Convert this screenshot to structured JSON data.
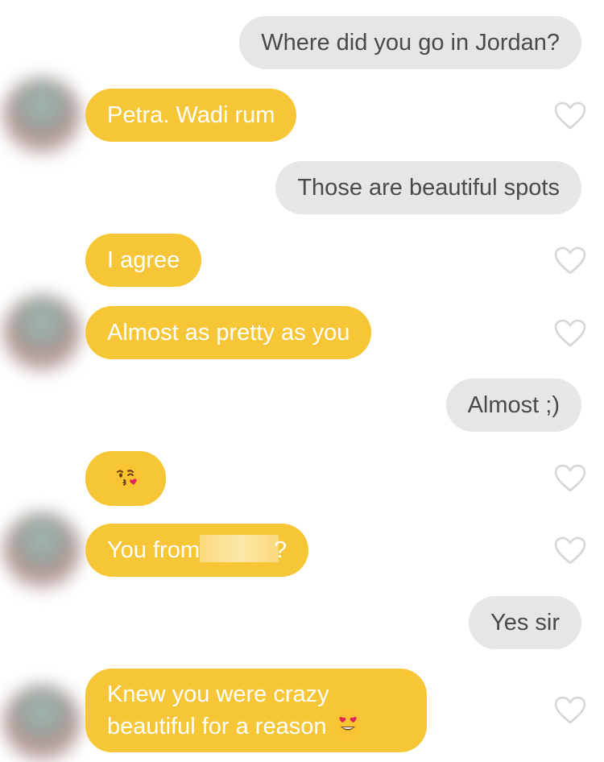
{
  "conversation": {
    "messages": [
      {
        "side": "out",
        "text": "Where did you go in Jordan?"
      },
      {
        "side": "in",
        "text": "Petra. Wadi rum"
      },
      {
        "side": "out",
        "text": "Those are beautiful spots"
      },
      {
        "side": "in",
        "text": "I agree"
      },
      {
        "side": "in",
        "text": "Almost as pretty as you"
      },
      {
        "side": "out",
        "text": "Almost ;)"
      },
      {
        "side": "in",
        "emoji": "kissing-face-emoji"
      },
      {
        "side": "in",
        "text_before": "You from",
        "text_after": "?",
        "redacted": true
      },
      {
        "side": "out",
        "text": "Yes sir"
      },
      {
        "side": "in",
        "line1": "Knew you were crazy",
        "line2": "beautiful for a reason",
        "emoji": "heart-eyes-emoji"
      }
    ]
  },
  "colors": {
    "incoming_bubble": "#f7c636",
    "outgoing_bubble": "#e6e6e6",
    "outgoing_text": "#4a4a4a",
    "heart_outline": "#d6d6d6"
  }
}
